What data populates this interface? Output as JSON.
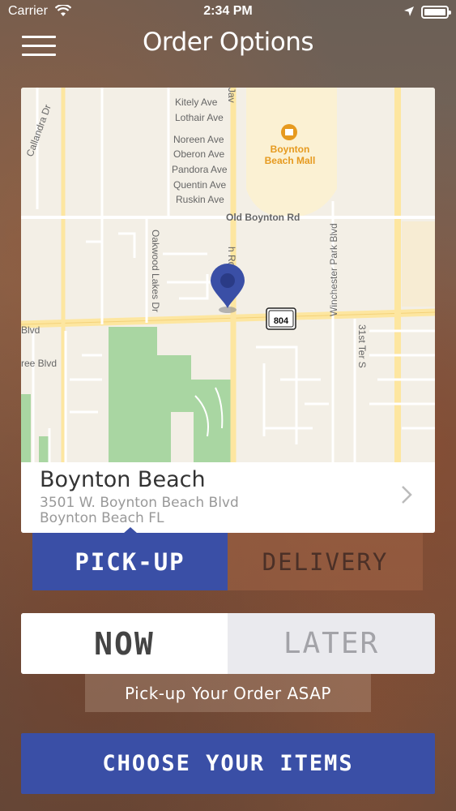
{
  "status_bar": {
    "carrier": "Carrier",
    "time": "2:34 PM"
  },
  "header": {
    "title": "Order Options",
    "menu_icon": "hamburger-menu-icon"
  },
  "map": {
    "streets": {
      "kitely": "Kitely Ave",
      "lothair": "Lothair Ave",
      "noreen": "Noreen Ave",
      "oberon": "Oberon Ave",
      "pandora": "Pandora Ave",
      "quentin": "Quentin Ave",
      "ruskin": "Ruskin Ave",
      "old_boynton": "Old Boynton Rd",
      "oakwood": "Oakwood Lakes Dr",
      "winchester": "Winchester Park Blvd",
      "ter31": "31st Ter S",
      "callandra": "Callandra Dr",
      "blvd_left": "Blvd",
      "ree_blvd": "ree Blvd",
      "jav": "Jav",
      "h_rd": "h Rd"
    },
    "poi": {
      "mall_line1": "Boynton",
      "mall_line2": "Beach Mall"
    },
    "route_shield": "804"
  },
  "location": {
    "name": "Boynton Beach",
    "address_line1": "3501 W. Boynton Beach Blvd",
    "address_line2": "Boynton Beach FL"
  },
  "order_type": {
    "pickup_label": "PICK-UP",
    "delivery_label": "DELIVERY",
    "selected": "pickup"
  },
  "timing": {
    "now_label": "NOW",
    "later_label": "LATER",
    "selected": "now",
    "note": "Pick-up Your Order ASAP"
  },
  "cta": {
    "label": "CHOOSE YOUR ITEMS"
  },
  "colors": {
    "accent": "#3a4fa6",
    "map_pin": "#3a4fa6",
    "poi_orange": "#e69a1f"
  }
}
